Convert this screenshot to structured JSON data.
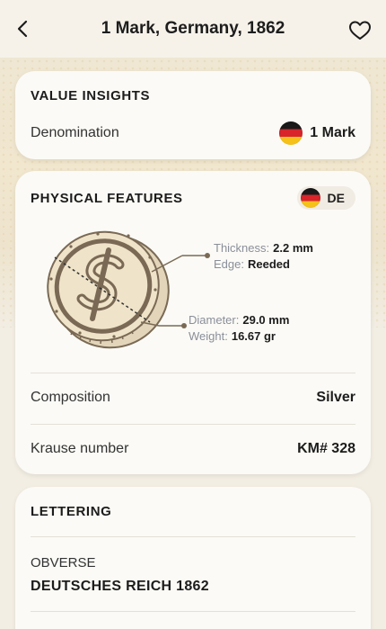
{
  "header": {
    "title": "1 Mark, Germany, 1862"
  },
  "value_insights": {
    "title": "VALUE INSIGHTS",
    "denomination_label": "Denomination",
    "denomination_value": "1 Mark"
  },
  "physical": {
    "title": "PHYSICAL FEATURES",
    "country_code": "DE",
    "thickness_label": "Thickness:",
    "thickness_value": "2.2 mm",
    "edge_label": "Edge:",
    "edge_value": "Reeded",
    "diameter_label": "Diameter:",
    "diameter_value": "29.0 mm",
    "weight_label": "Weight:",
    "weight_value": "16.67 gr",
    "composition_label": "Composition",
    "composition_value": "Silver",
    "krause_label": "Krause number",
    "krause_value": "KM# 328"
  },
  "lettering": {
    "title": "LETTERING",
    "obverse_label": "OBVERSE",
    "obverse_value": "DEUTSCHES REICH 1862"
  },
  "colors": {
    "background": "#f3eee3",
    "card": "#fbfaf6",
    "coin": "#e9dcc2",
    "coin_stroke": "#7a6a55"
  }
}
